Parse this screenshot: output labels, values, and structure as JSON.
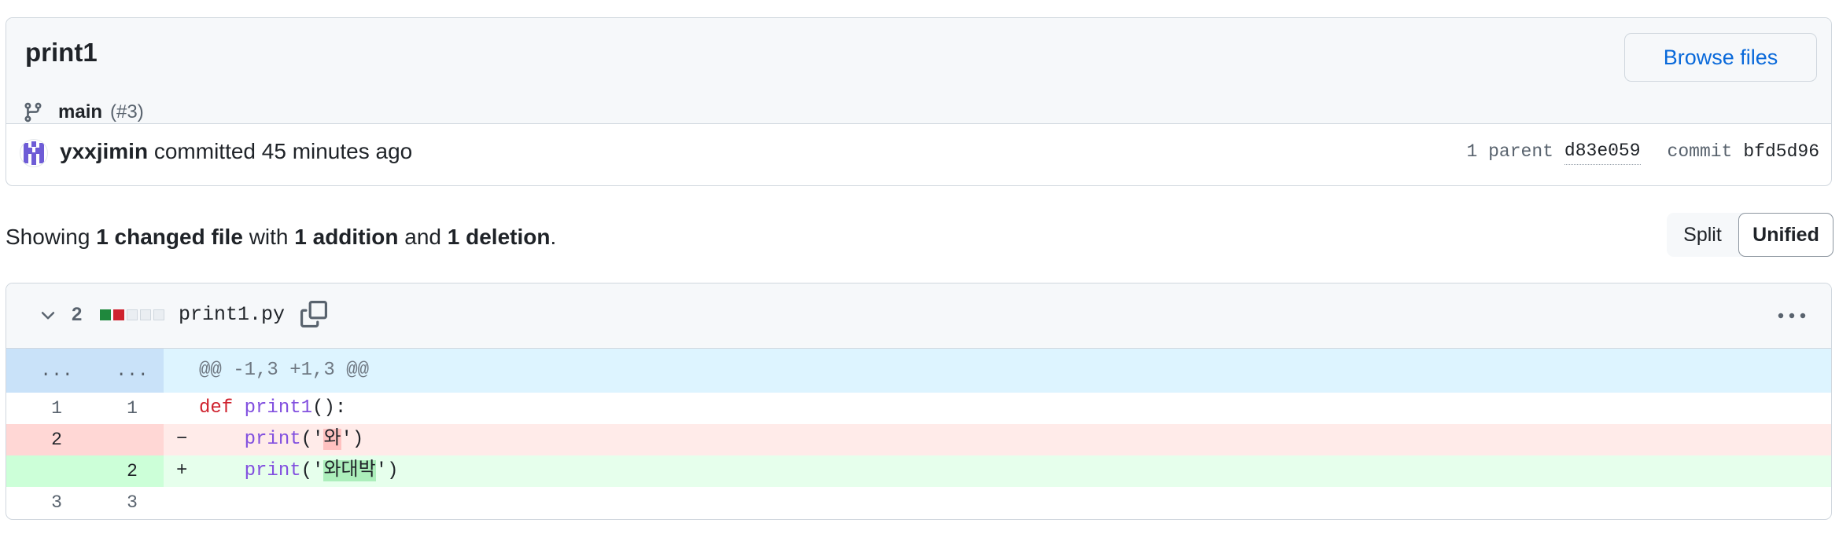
{
  "commit": {
    "title": "print1",
    "branch": "main",
    "pr_ref": "(#3)",
    "browse_files_label": "Browse files",
    "author": "yxxjimin",
    "action_text": "committed 45 minutes ago",
    "parent_label": "1 parent",
    "parent_sha": "d83e059",
    "commit_label": "commit",
    "commit_sha": "bfd5d96"
  },
  "summary": {
    "prefix": "Showing",
    "changed_files": "1 changed file",
    "with_text": "with",
    "additions": "1 addition",
    "and_text": "and",
    "deletions": "1 deletion",
    "suffix": "."
  },
  "view_toggle": {
    "split_label": "Split",
    "unified_label": "Unified",
    "selected": "Unified"
  },
  "file": {
    "change_count": "2",
    "name": "print1.py",
    "diffstat": [
      "add",
      "del",
      "neutral",
      "neutral",
      "neutral"
    ],
    "hunk_header": "@@ -1,3 +1,3 @@",
    "hunk_expand": "...",
    "lines": [
      {
        "type": "context",
        "old": "1",
        "new": "1",
        "marker": "",
        "tokens": {
          "kw": "def",
          "fn": "print1",
          "rest": "():"
        }
      },
      {
        "type": "del",
        "old": "2",
        "new": "",
        "marker": "−",
        "indent": "    ",
        "call": "print",
        "open": "('",
        "changed": "와",
        "close": "')"
      },
      {
        "type": "add",
        "old": "",
        "new": "2",
        "marker": "+",
        "indent": "    ",
        "call": "print",
        "open": "('",
        "changed": "와대박",
        "close": "')"
      },
      {
        "type": "context",
        "old": "3",
        "new": "3",
        "marker": "",
        "code": ""
      }
    ]
  },
  "colors": {
    "link": "#0969da",
    "addition": "#1f883d",
    "deletion": "#cf222e",
    "hunk_bg": "#ddf4ff",
    "avatar": "#6e5cd6"
  },
  "icons": {
    "branch": "git-branch-icon",
    "chevron": "chevron-down-icon",
    "copy": "copy-icon",
    "more": "kebab-horizontal-icon"
  }
}
